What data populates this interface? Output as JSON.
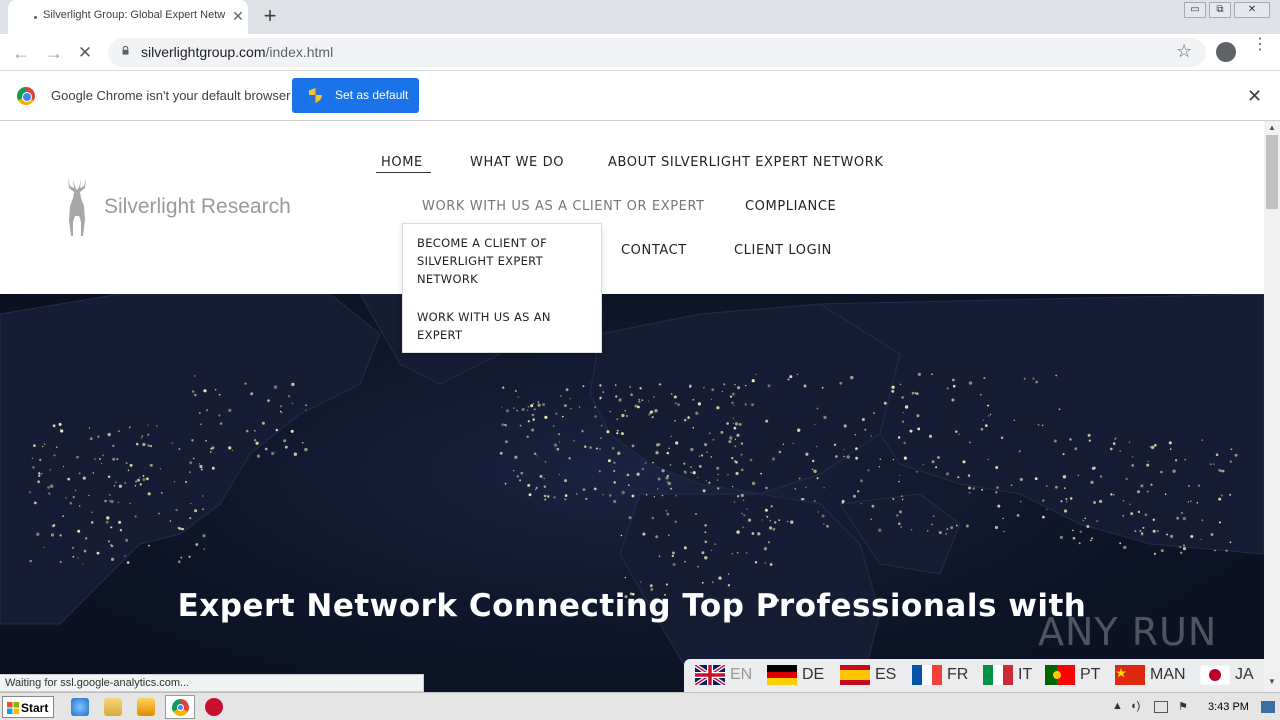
{
  "tab": {
    "title": "Silverlight Group: Global Expert Netw",
    "close": "✕",
    "new_tab": "+"
  },
  "window_controls": {
    "minimize": "▭",
    "maximize": "⧉",
    "close": "✕"
  },
  "toolbar": {
    "back_icon": "←",
    "forward_icon": "→",
    "reload_icon": "✕",
    "url_host": "silverlightgroup.com",
    "url_path": "/index.html",
    "star_icon": "☆",
    "menu_icon": "⋮"
  },
  "infobar": {
    "message": "Google Chrome isn't your default browser",
    "button_label": "Set as default",
    "close_icon": "✕"
  },
  "site": {
    "logo_text": "Silverlight Research",
    "nav": {
      "home": "HOME",
      "what_we_do": "WHAT WE DO",
      "about": "ABOUT SILVERLIGHT EXPERT NETWORK",
      "work_with_us": "WORK WITH US AS A CLIENT OR EXPERT",
      "compliance": "COMPLIANCE",
      "contact": "CONTACT",
      "client_login": "CLIENT LOGIN"
    },
    "dropdown": {
      "item_client": "BECOME A CLIENT OF SILVERLIGHT EXPERT NETWORK",
      "item_expert": "WORK WITH US AS AN EXPERT"
    },
    "hero_title": "Expert Network Connecting Top Professionals with",
    "languages": [
      {
        "code": "EN"
      },
      {
        "code": "DE"
      },
      {
        "code": "ES"
      },
      {
        "code": "FR"
      },
      {
        "code": "IT"
      },
      {
        "code": "PT"
      },
      {
        "code": "MAN"
      },
      {
        "code": "JA"
      }
    ]
  },
  "watermark": "ANY RUN",
  "status_text": "Waiting for ssl.google-analytics.com...",
  "taskbar": {
    "start_label": "Start",
    "clock": "3:43 PM"
  },
  "colors": {
    "chrome_blue": "#1a73e8",
    "hero_bg": "#0e1529",
    "city_lights": "#f3e7b0"
  }
}
